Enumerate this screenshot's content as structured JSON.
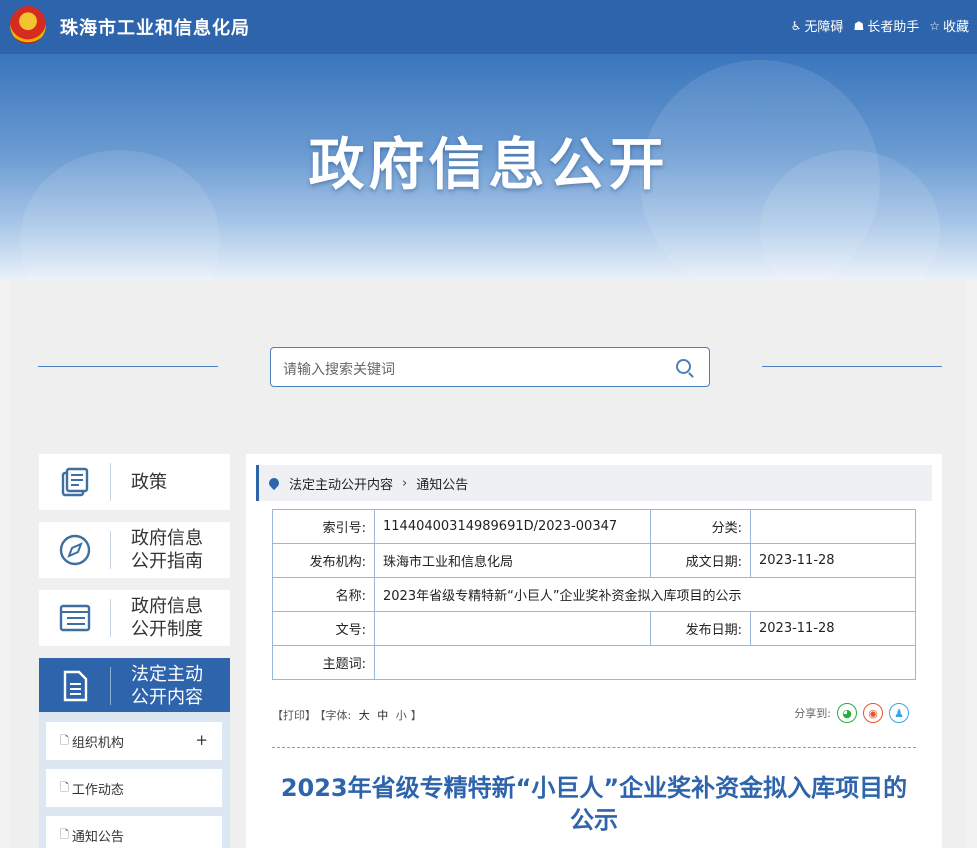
{
  "header": {
    "site_title": "珠海市工业和信息化局",
    "links": [
      {
        "icon": "accessibility-icon",
        "label": "无障碍"
      },
      {
        "icon": "elder-helper-icon",
        "label": "长者助手"
      },
      {
        "icon": "star-icon",
        "label": "收藏"
      }
    ],
    "banner_title": "政府信息公开"
  },
  "search": {
    "placeholder": "请输入搜索关键词"
  },
  "sidebar": {
    "items": [
      {
        "label": "政策",
        "icon": "policy-book-icon"
      },
      {
        "label": "政府信息公开指南",
        "icon": "compass-icon"
      },
      {
        "label": "政府信息公开制度",
        "icon": "list-icon"
      },
      {
        "label": "法定主动公开内容",
        "icon": "document-icon",
        "active": true
      }
    ],
    "subitems": [
      {
        "label": "组织机构",
        "expand": "+"
      },
      {
        "label": "工作动态"
      },
      {
        "label": "通知公告"
      }
    ]
  },
  "breadcrumb": {
    "items": [
      "法定主动公开内容",
      "通知公告"
    ]
  },
  "meta": {
    "index_label": "索引号:",
    "index_value": "11440400314989691D/2023-00347",
    "category_label": "分类:",
    "category_value": "",
    "publisher_label": "发布机构:",
    "publisher_value": "珠海市工业和信息化局",
    "created_label": "成文日期:",
    "created_value": "2023-11-28",
    "name_label": "名称:",
    "name_value": "2023年省级专精特新“小巨人”企业奖补资金拟入库项目的公示",
    "docno_label": "文号:",
    "docno_value": "",
    "published_label": "发布日期:",
    "published_value": "2023-11-28",
    "subject_label": "主题词:",
    "subject_value": ""
  },
  "tools": {
    "print": "【打印】",
    "font_label": "【字体:",
    "font_large": "大",
    "font_medium": "中",
    "font_small": "小",
    "font_end": "】",
    "share_label": "分享到:"
  },
  "article": {
    "title": "2023年省级专精特新“小巨人”企业奖补资金拟入库项目的公示"
  },
  "colors": {
    "primary": "#2d64ab",
    "wechat": "#2bad3f",
    "weibo": "#e4572e",
    "qq": "#3ba3e6"
  }
}
